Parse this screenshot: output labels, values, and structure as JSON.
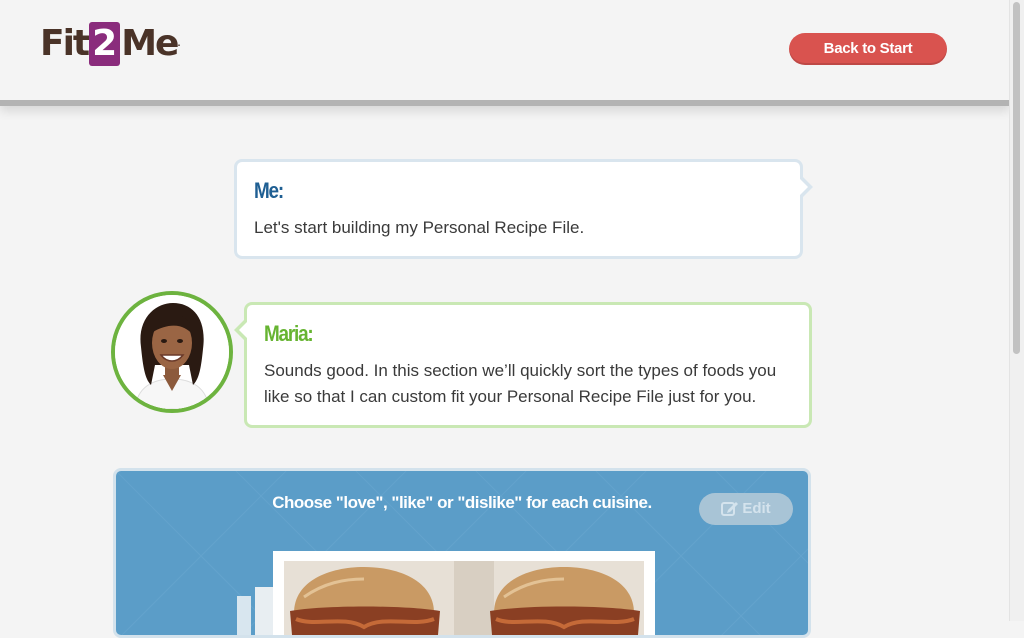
{
  "header": {
    "logo": {
      "prefix": "Fit",
      "highlight": "2",
      "suffix": "Me",
      "mark": "."
    },
    "back_button": "Back to Start"
  },
  "conversation": [
    {
      "speaker": "Me:",
      "text": "Let's start building my Personal Recipe File."
    },
    {
      "speaker": "Maria:",
      "text": "Sounds good. In this section we’ll quickly sort the types of foods you like so that I can custom fit your Personal Recipe File just for you."
    }
  ],
  "panel": {
    "prompt": "Choose \"love\", \"like\" or \"dislike\" for each cuisine.",
    "edit_button": "Edit",
    "photo_icon": "sandwich-photo"
  },
  "colors": {
    "brand_purple": "#8a2c7c",
    "brand_brown": "#4a3328",
    "back_button": "#d9534f",
    "me_label": "#1f5f93",
    "maria_label": "#66b431",
    "panel_blue": "#5b9dc8"
  }
}
